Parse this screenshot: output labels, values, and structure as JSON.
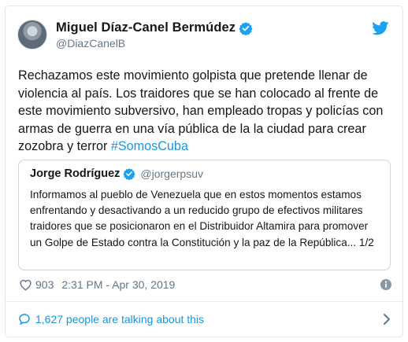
{
  "tweet": {
    "author": {
      "display_name": "Miguel Díaz-Canel Bermúdez",
      "handle": "@DiazCanelB",
      "verified": true
    },
    "text_main": "Rechazamos este movimiento golpista que pretende llenar de violencia al país. Los traidores que se han colocado al frente de este movimiento subversivo, han empleado tropas y policías con armas de guerra en una vía pública de la la ciudad para crear zozobra y terror ",
    "hashtag": "#SomosCuba",
    "quoted": {
      "display_name": "Jorge Rodríguez",
      "handle": "@jorgerpsuv",
      "verified": true,
      "text": "Informamos al pueblo de Venezuela que en estos momentos estamos enfrentando y desactivando a un reducido grupo de efectivos militares traidores que se posicionaron en el Distribuidor Altamira para promover un Golpe de Estado contra la Constitución y la paz de la República... 1/2"
    },
    "likes": "903",
    "timestamp": "2:31 PM - Apr 30, 2019",
    "talking": "1,627 people are talking about this"
  },
  "icons": {
    "brand": "twitter-bird-icon",
    "verified": "verified-badge-icon",
    "like": "heart-icon",
    "info": "info-icon",
    "conversation": "speech-bubble-icon",
    "chevron": "chevron-right-icon"
  },
  "colors": {
    "brand_blue": "#1da1f2",
    "link_blue": "#1b95e0",
    "secondary_text": "#657786",
    "border": "#e1e8ed"
  }
}
